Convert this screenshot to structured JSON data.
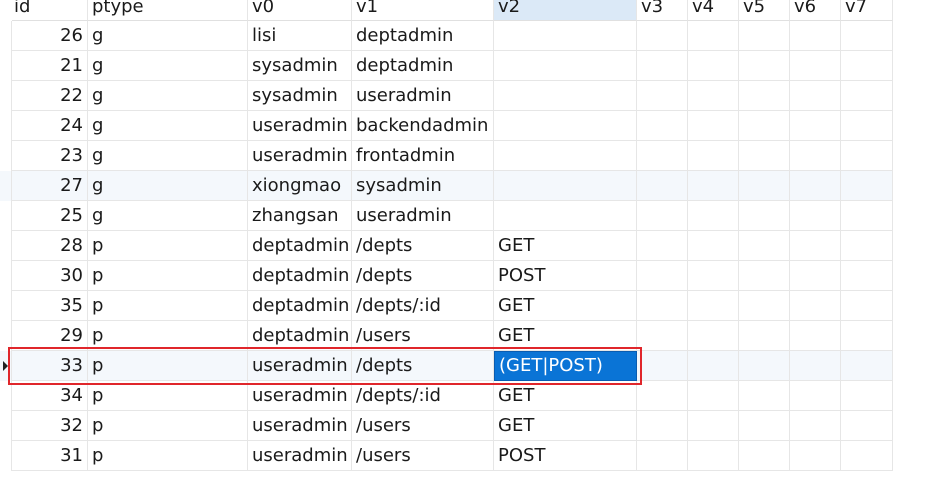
{
  "columns": [
    "id",
    "ptype",
    "v0",
    "v1",
    "v2",
    "v3",
    "v4",
    "v5",
    "v6",
    "v7"
  ],
  "rows": [
    {
      "id": "26",
      "ptype": "g",
      "v0": "lisi",
      "v1": "deptadmin",
      "v2": ""
    },
    {
      "id": "21",
      "ptype": "g",
      "v0": "sysadmin",
      "v1": "deptadmin",
      "v2": ""
    },
    {
      "id": "22",
      "ptype": "g",
      "v0": "sysadmin",
      "v1": "useradmin",
      "v2": ""
    },
    {
      "id": "24",
      "ptype": "g",
      "v0": "useradmin",
      "v1": "backendadmin",
      "v2": ""
    },
    {
      "id": "23",
      "ptype": "g",
      "v0": "useradmin",
      "v1": "frontadmin",
      "v2": ""
    },
    {
      "id": "27",
      "ptype": "g",
      "v0": "xiongmao",
      "v1": "sysadmin",
      "v2": ""
    },
    {
      "id": "25",
      "ptype": "g",
      "v0": "zhangsan",
      "v1": "useradmin",
      "v2": ""
    },
    {
      "id": "28",
      "ptype": "p",
      "v0": "deptadmin",
      "v1": "/depts",
      "v2": "GET"
    },
    {
      "id": "30",
      "ptype": "p",
      "v0": "deptadmin",
      "v1": "/depts",
      "v2": "POST"
    },
    {
      "id": "35",
      "ptype": "p",
      "v0": "deptadmin",
      "v1": "/depts/:id",
      "v2": "GET"
    },
    {
      "id": "29",
      "ptype": "p",
      "v0": "deptadmin",
      "v1": "/users",
      "v2": "GET"
    },
    {
      "id": "33",
      "ptype": "p",
      "v0": "useradmin",
      "v1": "/depts",
      "v2": "(GET|POST)"
    },
    {
      "id": "34",
      "ptype": "p",
      "v0": "useradmin",
      "v1": "/depts/:id",
      "v2": "GET"
    },
    {
      "id": "32",
      "ptype": "p",
      "v0": "useradmin",
      "v1": "/users",
      "v2": "GET"
    },
    {
      "id": "31",
      "ptype": "p",
      "v0": "useradmin",
      "v1": "/users",
      "v2": "POST"
    }
  ]
}
